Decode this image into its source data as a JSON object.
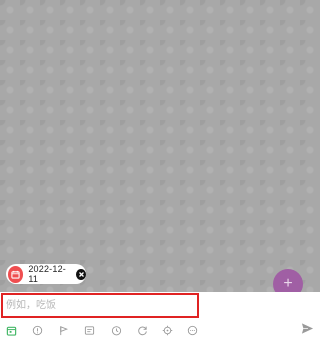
{
  "task_composer": {
    "date_chip": {
      "date": "2022-12-11"
    },
    "input": {
      "value": "",
      "placeholder": "例如，吃饭"
    },
    "fab": {
      "label": "+"
    },
    "toolbar": {
      "icons": [
        "calendar-icon",
        "priority-icon",
        "flag-icon",
        "list-icon",
        "reminder-icon",
        "repeat-icon",
        "location-icon",
        "more-icon",
        "send-icon"
      ]
    }
  },
  "colors": {
    "accent_red": "#ef4e50",
    "fab_purple": "#a05fa4",
    "calendar_green": "#46b868",
    "icon_gray": "#9a9a9a",
    "highlight_border": "#e02323"
  }
}
